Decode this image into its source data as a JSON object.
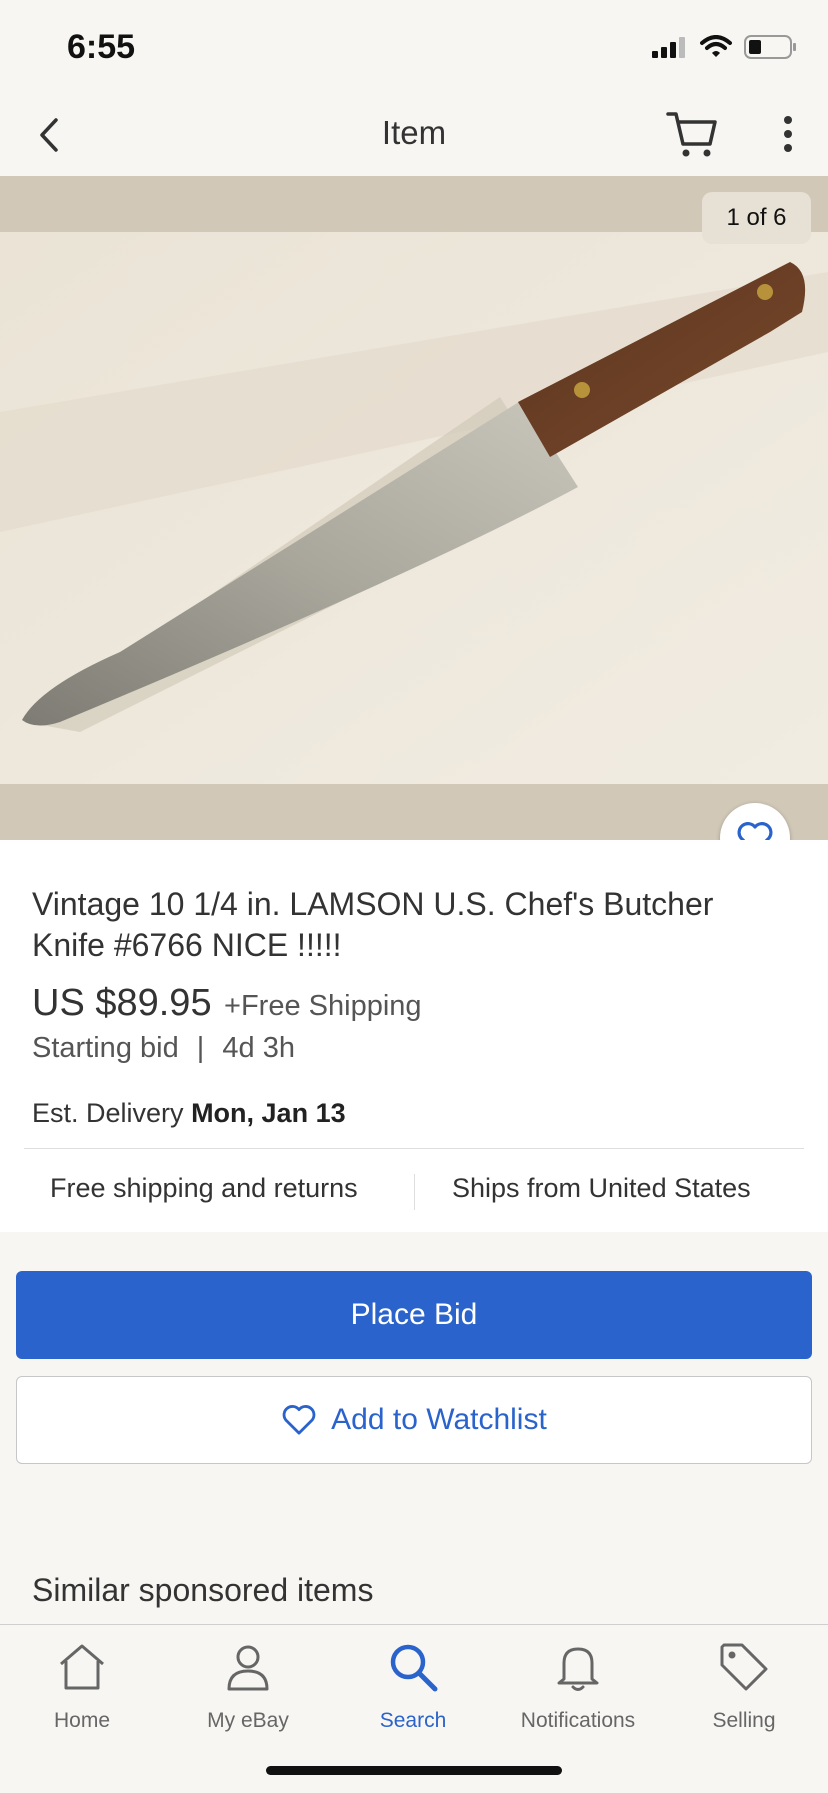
{
  "status_bar": {
    "time": "6:55"
  },
  "navbar": {
    "title": "Item"
  },
  "gallery": {
    "counter": "1 of 6"
  },
  "listing": {
    "title": "Vintage 10 1/4 in. LAMSON U.S. Chef's Butcher Knife #6766  NICE !!!!!",
    "price": "US $89.95",
    "shipping": "+Free Shipping",
    "bid_label": "Starting bid",
    "separator": "|",
    "time_left": "4d 3h",
    "delivery_label": "Est. Delivery",
    "delivery_date": "Mon, Jan 13",
    "feature_left": "Free shipping and returns",
    "feature_right": "Ships from United States"
  },
  "actions": {
    "place_bid": "Place Bid",
    "add_watchlist": "Add to Watchlist"
  },
  "similar": {
    "heading": "Similar sponsored items"
  },
  "tabbar": {
    "items": [
      {
        "label": "Home",
        "icon": "home-icon"
      },
      {
        "label": "My eBay",
        "icon": "person-icon"
      },
      {
        "label": "Search",
        "icon": "search-icon",
        "active": true
      },
      {
        "label": "Notifications",
        "icon": "bell-icon"
      },
      {
        "label": "Selling",
        "icon": "tag-icon"
      }
    ]
  },
  "colors": {
    "accent": "#2b63cc",
    "background": "#f7f6f3"
  }
}
